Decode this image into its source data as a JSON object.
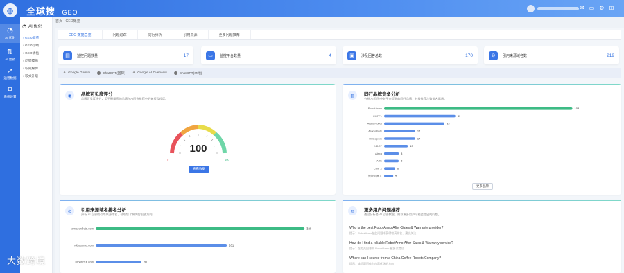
{
  "brand": {
    "name": "全球搜",
    "product": "· GEO"
  },
  "rail": [
    {
      "label": "AI 优化",
      "icon": "◔"
    },
    {
      "label": "AI 营销",
      "icon": "⇅"
    },
    {
      "label": "运营数据",
      "icon": "↗"
    },
    {
      "label": "系统设置",
      "icon": "⚙"
    }
  ],
  "submenu": {
    "title": "AI 优化",
    "items": [
      "GEO概览",
      "GEO诊断",
      "GEO优化",
      "问答覆盖",
      "权威媒体",
      "软文升级"
    ]
  },
  "breadcrumb": "首页 · GEO概览",
  "tabs": [
    "GEO 数据总览",
    "问题追踪",
    "同行分析",
    "引用来源",
    "更多问题推荐"
  ],
  "stats": [
    {
      "label": "监控问题数量",
      "value": "17",
      "icon": "▤"
    },
    {
      "label": "监控平台数量",
      "value": "4",
      "icon": "▭"
    },
    {
      "label": "涉及回答总数",
      "value": "170",
      "icon": "▣"
    },
    {
      "label": "引用来源域名数",
      "value": "219",
      "icon": "⊘"
    }
  ],
  "engines": [
    {
      "name": "Google Gemini",
      "mark": "diamond"
    },
    {
      "name": "ChatGPT(国际)",
      "mark": "dot"
    },
    {
      "name": "Google AI Overview",
      "mark": "diamond"
    },
    {
      "name": "ChatGPT(本地)",
      "mark": "dot"
    }
  ],
  "visibility": {
    "title": "品牌可见度评分",
    "subtitle": "品牌可见度评分，用于衡量您的品牌在AI回答推荐中的被提及程度。",
    "score": "100",
    "min": "0",
    "max": "100",
    "button": "查看数据"
  },
  "competitors": {
    "title": "同行品牌竞争分析",
    "subtitle": "分析 AI 回答中各平台提到的同行品牌，并按推荐次数排名展示。",
    "more": "更多品牌"
  },
  "sources": {
    "title": "引用来源域名排名分析",
    "subtitle": "分析 AI 回答的引用来源域名，帮助您了解内容投放方向。"
  },
  "questions": {
    "title": "更多用户问题推荐",
    "subtitle": "通过分析各 AI 回答数据，推荐更多用户可能会提出的问题。",
    "items": [
      {
        "q": "Who is the best RobotArmo After-Sales & Warranty provider?",
        "a": "提示：RobotArmo在此问题中获得较高排名，建议关注"
      },
      {
        "q": "How do I find a reliable RobotArmo After-Sales & Warranty service?",
        "a": "提示：在相关回答中 RobotArmo 被多次提及"
      },
      {
        "q": "Where can I source from a China Coffee Robots Company?",
        "a": "提示：该问题可作为内容优化的方向"
      }
    ]
  },
  "watermark": "大数跨境",
  "chart_data": [
    {
      "type": "bar",
      "orientation": "horizontal",
      "title": "同行品牌竞争分析",
      "categories": [
        "RobotArmo",
        "COFFe",
        "Arato Robot",
        "AromaBots",
        "Hi-Dolphin",
        "XBOT",
        "Alexa",
        "Artly",
        "Cafe X",
        "智能机器人"
      ],
      "values": [
        103,
        39,
        33,
        17,
        17,
        13,
        8,
        8,
        6,
        5
      ],
      "colors": [
        "#3dbb85",
        "#5b8ee8",
        "#5b8ee8",
        "#5b8ee8",
        "#5b8ee8",
        "#5b8ee8",
        "#5b8ee8",
        "#5b8ee8",
        "#5b8ee8",
        "#5b8ee8"
      ],
      "xlim": [
        0,
        110
      ]
    },
    {
      "type": "bar",
      "orientation": "horizontal",
      "title": "引用来源域名排名分析",
      "categories": [
        "amazonbots.com",
        "robotarmo.com",
        "roboticsX.com"
      ],
      "values": [
        320,
        201,
        70
      ],
      "colors": [
        "#3dbb85",
        "#5b8ee8",
        "#5b8ee8"
      ],
      "xlim": [
        0,
        340
      ]
    }
  ]
}
